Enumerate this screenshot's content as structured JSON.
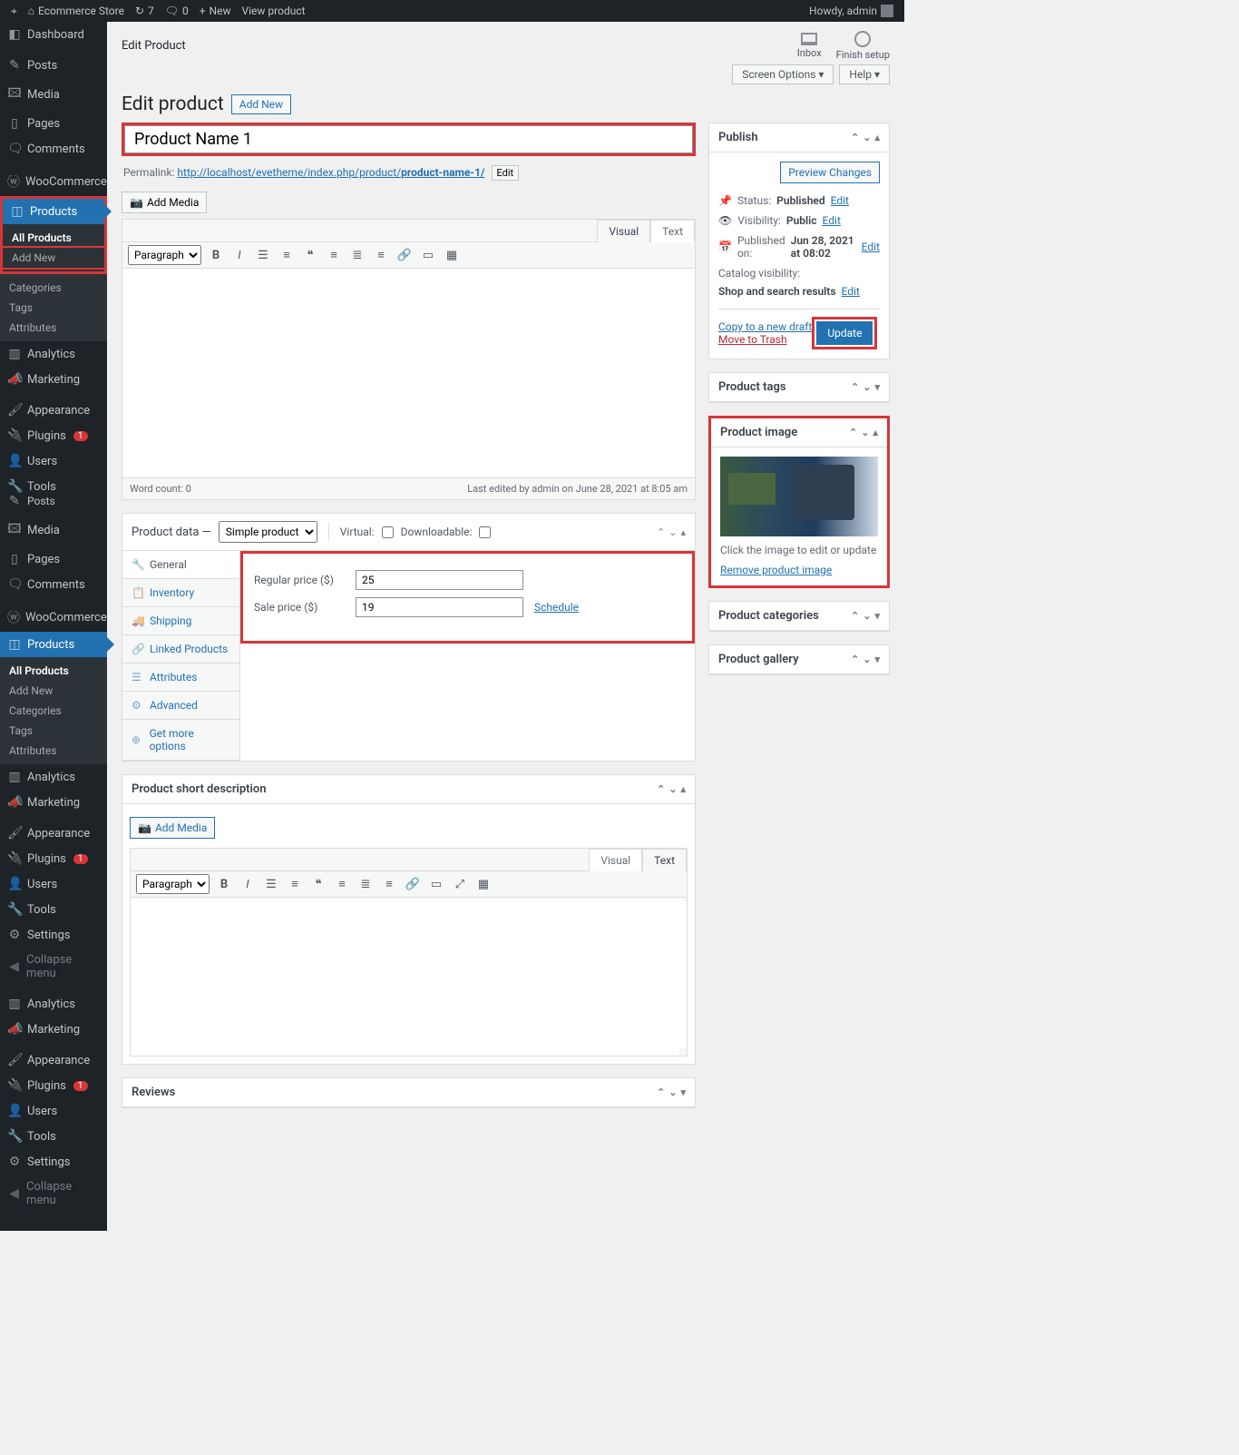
{
  "adminbar": {
    "site": "Ecommerce Store",
    "updates": "7",
    "comments": "0",
    "new": "New",
    "view": "View product",
    "howdy": "Howdy, admin"
  },
  "sidebar": {
    "dashboard": "Dashboard",
    "posts": "Posts",
    "media": "Media",
    "pages": "Pages",
    "comments": "Comments",
    "woocommerce": "WooCommerce",
    "products": "Products",
    "sub_all": "All Products",
    "sub_add": "Add New",
    "sub_cat": "Categories",
    "sub_tags": "Tags",
    "sub_attr": "Attributes",
    "analytics": "Analytics",
    "marketing": "Marketing",
    "appearance": "Appearance",
    "plugins": "Plugins",
    "plugins_count": "1",
    "users": "Users",
    "tools": "Tools",
    "settings": "Settings",
    "collapse": "Collapse menu"
  },
  "top": {
    "breadcrumb": "Edit Product",
    "inbox": "Inbox",
    "finish": "Finish setup",
    "screen_options": "Screen Options ▾",
    "help": "Help ▾"
  },
  "page": {
    "heading": "Edit product",
    "add_new": "Add New",
    "title_value": "Product Name 1",
    "permalink_label": "Permalink:",
    "permalink_base": "http://localhost/evetheme/index.php/product/",
    "permalink_slug": "product-name-1/",
    "permalink_edit": "Edit",
    "add_media": "Add Media",
    "visual": "Visual",
    "text": "Text",
    "paragraph": "Paragraph",
    "word_count": "Word count: 0",
    "last_edited": "Last edited by admin on June 28, 2021 at 8:05 am"
  },
  "product_data": {
    "title": "Product data —",
    "type": "Simple product",
    "virtual": "Virtual:",
    "downloadable": "Downloadable:",
    "tabs": {
      "general": "General",
      "inventory": "Inventory",
      "shipping": "Shipping",
      "linked": "Linked Products",
      "attributes": "Attributes",
      "advanced": "Advanced",
      "more": "Get more options"
    },
    "regular_label": "Regular price ($)",
    "regular_value": "25",
    "sale_label": "Sale price ($)",
    "sale_value": "19",
    "schedule": "Schedule"
  },
  "short_desc": {
    "title": "Product short description"
  },
  "reviews": {
    "title": "Reviews"
  },
  "publish": {
    "title": "Publish",
    "preview": "Preview Changes",
    "status_lbl": "Status:",
    "status_val": "Published",
    "visibility_lbl": "Visibility:",
    "visibility_val": "Public",
    "published_lbl": "Published on:",
    "published_val": "Jun 28, 2021 at 08:02",
    "catalog_lbl": "Catalog visibility:",
    "catalog_val": "Shop and search results",
    "edit": "Edit",
    "copy": "Copy to a new draft",
    "trash": "Move to Trash",
    "update": "Update"
  },
  "tags_box": {
    "title": "Product tags"
  },
  "image_box": {
    "title": "Product image",
    "hint": "Click the image to edit or update",
    "remove": "Remove product image"
  },
  "categories_box": {
    "title": "Product categories"
  },
  "gallery_box": {
    "title": "Product gallery"
  }
}
